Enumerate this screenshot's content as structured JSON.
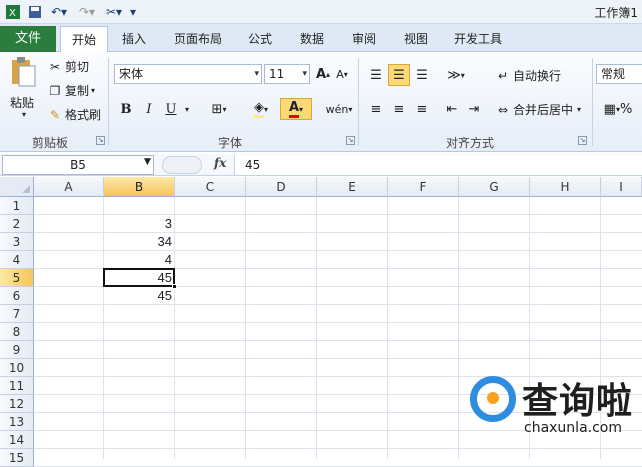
{
  "title": "工作簿1",
  "quick_access": {
    "save_icon": "save-icon",
    "undo_icon": "undo-icon",
    "redo_icon": "redo-icon",
    "tools_icon": "tools-icon"
  },
  "tabs": {
    "file": "文件",
    "home": "开始",
    "insert": "插入",
    "layout": "页面布局",
    "formulas": "公式",
    "data": "数据",
    "review": "审阅",
    "view": "视图",
    "developer": "开发工具"
  },
  "clipboard": {
    "paste": "粘贴",
    "cut": "剪切",
    "copy": "复制",
    "format_painter": "格式刷",
    "group": "剪贴板"
  },
  "font": {
    "name": "宋体",
    "size": "11",
    "bold": "B",
    "italic": "I",
    "underline": "U",
    "grow": "A",
    "shrink": "A",
    "group": "字体"
  },
  "alignment": {
    "wrap": "自动换行",
    "merge": "合并后居中",
    "group": "对齐方式"
  },
  "number": {
    "format": "常规"
  },
  "formula_bar": {
    "name_box": "B5",
    "fx": "fx",
    "value": "45"
  },
  "columns": [
    "A",
    "B",
    "C",
    "D",
    "E",
    "F",
    "G",
    "H",
    "I"
  ],
  "rows": [
    "1",
    "2",
    "3",
    "4",
    "5",
    "6",
    "7",
    "8",
    "9",
    "10",
    "11",
    "12",
    "13",
    "14",
    "15"
  ],
  "cells": {
    "B2": "3",
    "B3": "34",
    "B4": "4",
    "B5": "45",
    "B6": "45"
  },
  "selected_cell": "B5",
  "watermark": {
    "text": "查询啦",
    "url": "chaxunla.com"
  }
}
